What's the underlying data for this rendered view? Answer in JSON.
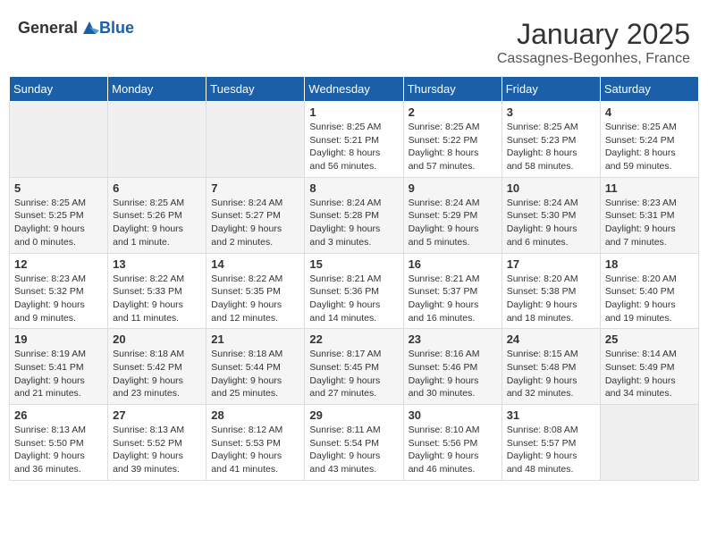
{
  "header": {
    "logo_general": "General",
    "logo_blue": "Blue",
    "month": "January 2025",
    "location": "Cassagnes-Begonhes, France"
  },
  "weekdays": [
    "Sunday",
    "Monday",
    "Tuesday",
    "Wednesday",
    "Thursday",
    "Friday",
    "Saturday"
  ],
  "weeks": [
    [
      {
        "day": "",
        "info": ""
      },
      {
        "day": "",
        "info": ""
      },
      {
        "day": "",
        "info": ""
      },
      {
        "day": "1",
        "info": "Sunrise: 8:25 AM\nSunset: 5:21 PM\nDaylight: 8 hours\nand 56 minutes."
      },
      {
        "day": "2",
        "info": "Sunrise: 8:25 AM\nSunset: 5:22 PM\nDaylight: 8 hours\nand 57 minutes."
      },
      {
        "day": "3",
        "info": "Sunrise: 8:25 AM\nSunset: 5:23 PM\nDaylight: 8 hours\nand 58 minutes."
      },
      {
        "day": "4",
        "info": "Sunrise: 8:25 AM\nSunset: 5:24 PM\nDaylight: 8 hours\nand 59 minutes."
      }
    ],
    [
      {
        "day": "5",
        "info": "Sunrise: 8:25 AM\nSunset: 5:25 PM\nDaylight: 9 hours\nand 0 minutes."
      },
      {
        "day": "6",
        "info": "Sunrise: 8:25 AM\nSunset: 5:26 PM\nDaylight: 9 hours\nand 1 minute."
      },
      {
        "day": "7",
        "info": "Sunrise: 8:24 AM\nSunset: 5:27 PM\nDaylight: 9 hours\nand 2 minutes."
      },
      {
        "day": "8",
        "info": "Sunrise: 8:24 AM\nSunset: 5:28 PM\nDaylight: 9 hours\nand 3 minutes."
      },
      {
        "day": "9",
        "info": "Sunrise: 8:24 AM\nSunset: 5:29 PM\nDaylight: 9 hours\nand 5 minutes."
      },
      {
        "day": "10",
        "info": "Sunrise: 8:24 AM\nSunset: 5:30 PM\nDaylight: 9 hours\nand 6 minutes."
      },
      {
        "day": "11",
        "info": "Sunrise: 8:23 AM\nSunset: 5:31 PM\nDaylight: 9 hours\nand 7 minutes."
      }
    ],
    [
      {
        "day": "12",
        "info": "Sunrise: 8:23 AM\nSunset: 5:32 PM\nDaylight: 9 hours\nand 9 minutes."
      },
      {
        "day": "13",
        "info": "Sunrise: 8:22 AM\nSunset: 5:33 PM\nDaylight: 9 hours\nand 11 minutes."
      },
      {
        "day": "14",
        "info": "Sunrise: 8:22 AM\nSunset: 5:35 PM\nDaylight: 9 hours\nand 12 minutes."
      },
      {
        "day": "15",
        "info": "Sunrise: 8:21 AM\nSunset: 5:36 PM\nDaylight: 9 hours\nand 14 minutes."
      },
      {
        "day": "16",
        "info": "Sunrise: 8:21 AM\nSunset: 5:37 PM\nDaylight: 9 hours\nand 16 minutes."
      },
      {
        "day": "17",
        "info": "Sunrise: 8:20 AM\nSunset: 5:38 PM\nDaylight: 9 hours\nand 18 minutes."
      },
      {
        "day": "18",
        "info": "Sunrise: 8:20 AM\nSunset: 5:40 PM\nDaylight: 9 hours\nand 19 minutes."
      }
    ],
    [
      {
        "day": "19",
        "info": "Sunrise: 8:19 AM\nSunset: 5:41 PM\nDaylight: 9 hours\nand 21 minutes."
      },
      {
        "day": "20",
        "info": "Sunrise: 8:18 AM\nSunset: 5:42 PM\nDaylight: 9 hours\nand 23 minutes."
      },
      {
        "day": "21",
        "info": "Sunrise: 8:18 AM\nSunset: 5:44 PM\nDaylight: 9 hours\nand 25 minutes."
      },
      {
        "day": "22",
        "info": "Sunrise: 8:17 AM\nSunset: 5:45 PM\nDaylight: 9 hours\nand 27 minutes."
      },
      {
        "day": "23",
        "info": "Sunrise: 8:16 AM\nSunset: 5:46 PM\nDaylight: 9 hours\nand 30 minutes."
      },
      {
        "day": "24",
        "info": "Sunrise: 8:15 AM\nSunset: 5:48 PM\nDaylight: 9 hours\nand 32 minutes."
      },
      {
        "day": "25",
        "info": "Sunrise: 8:14 AM\nSunset: 5:49 PM\nDaylight: 9 hours\nand 34 minutes."
      }
    ],
    [
      {
        "day": "26",
        "info": "Sunrise: 8:13 AM\nSunset: 5:50 PM\nDaylight: 9 hours\nand 36 minutes."
      },
      {
        "day": "27",
        "info": "Sunrise: 8:13 AM\nSunset: 5:52 PM\nDaylight: 9 hours\nand 39 minutes."
      },
      {
        "day": "28",
        "info": "Sunrise: 8:12 AM\nSunset: 5:53 PM\nDaylight: 9 hours\nand 41 minutes."
      },
      {
        "day": "29",
        "info": "Sunrise: 8:11 AM\nSunset: 5:54 PM\nDaylight: 9 hours\nand 43 minutes."
      },
      {
        "day": "30",
        "info": "Sunrise: 8:10 AM\nSunset: 5:56 PM\nDaylight: 9 hours\nand 46 minutes."
      },
      {
        "day": "31",
        "info": "Sunrise: 8:08 AM\nSunset: 5:57 PM\nDaylight: 9 hours\nand 48 minutes."
      },
      {
        "day": "",
        "info": ""
      }
    ]
  ]
}
